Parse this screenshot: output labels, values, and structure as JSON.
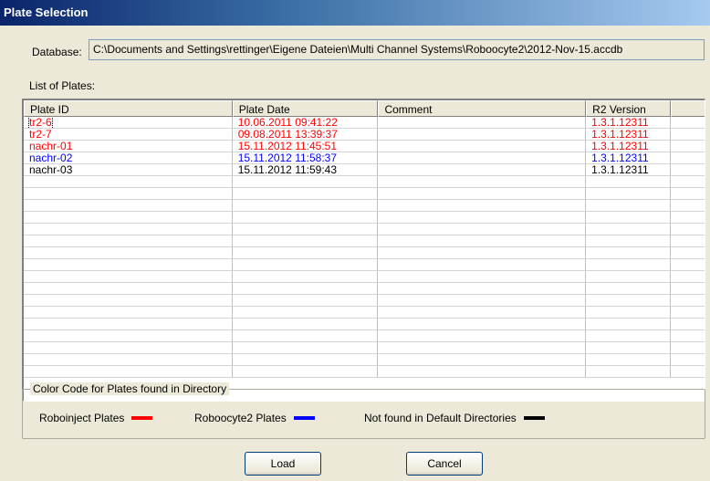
{
  "window": {
    "title": "Plate Selection"
  },
  "database": {
    "label": "Database:",
    "path": "C:\\Documents and Settings\\rettinger\\Eigene Dateien\\Multi Channel Systems\\Roboocyte2\\2012-Nov-15.accdb"
  },
  "plates": {
    "label": "List of Plates:",
    "columns": [
      "Plate ID",
      "Plate Date",
      "Comment",
      "R2 Version",
      ""
    ],
    "rows": [
      {
        "id": "tr2-6",
        "date": "10.06.2011 09:41:22",
        "comment": "",
        "version": "1.3.1.12311",
        "color": "#ff0000"
      },
      {
        "id": "tr2-7",
        "date": "09.08.2011 13:39:37",
        "comment": "",
        "version": "1.3.1.12311",
        "color": "#ff0000"
      },
      {
        "id": "nachr-01",
        "date": "15.11.2012 11:45:51",
        "comment": "",
        "version": "1.3.1.12311",
        "color": "#ff0000"
      },
      {
        "id": "nachr-02",
        "date": "15.11.2012 11:58:37",
        "comment": "",
        "version": "1.3.1.12311",
        "color": "#0000ff"
      },
      {
        "id": "nachr-03",
        "date": "15.11.2012 11:59:43",
        "comment": "",
        "version": "1.3.1.12311",
        "color": "#000000"
      }
    ]
  },
  "color_code": {
    "title": "Color Code for Plates found in Directory",
    "items": [
      {
        "label": "Roboinject Plates",
        "color": "#ff0000"
      },
      {
        "label": "Roboocyte2 Plates",
        "color": "#0000ff"
      },
      {
        "label": "Not found in Default Directories",
        "color": "#000000"
      }
    ]
  },
  "buttons": {
    "load": "Load",
    "cancel": "Cancel"
  }
}
